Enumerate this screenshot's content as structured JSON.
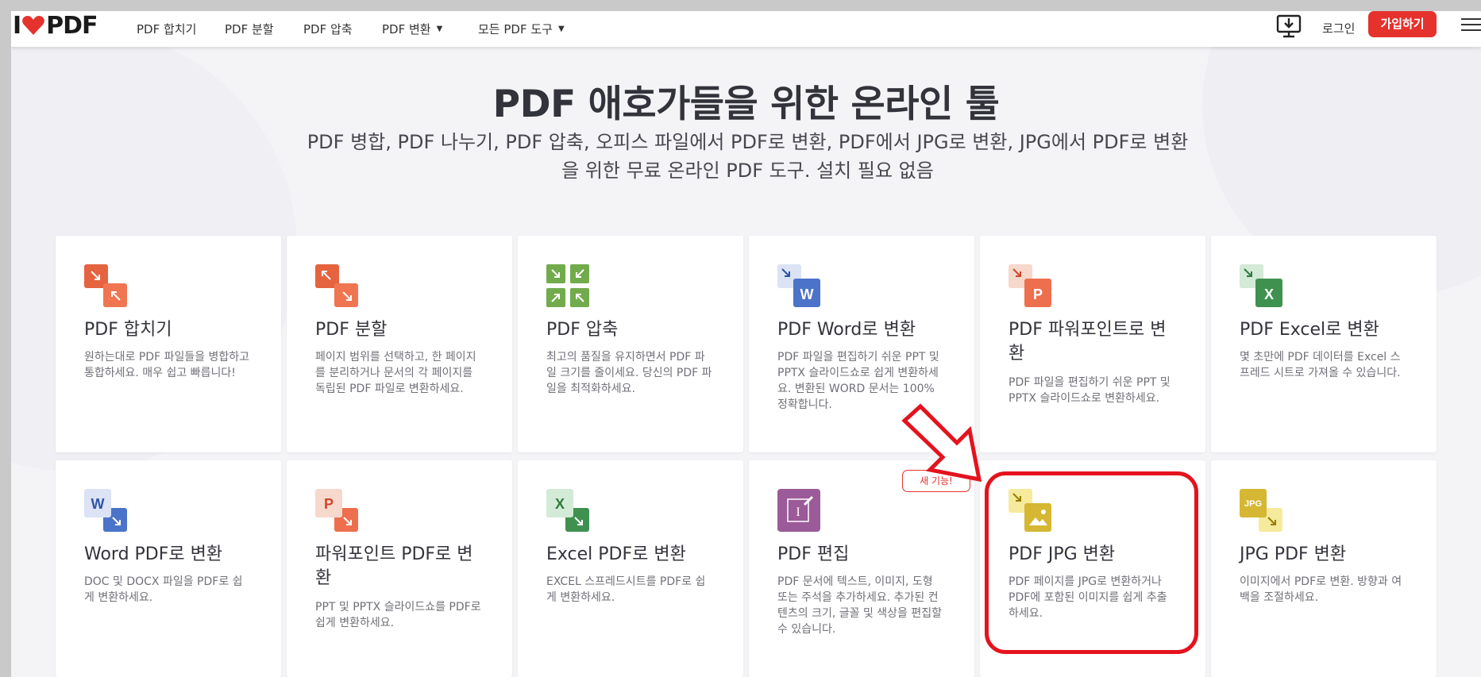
{
  "header": {
    "logo_text_left": "I",
    "logo_text_right": "PDF",
    "nav": [
      {
        "label": "PDF 합치기"
      },
      {
        "label": "PDF 분할"
      },
      {
        "label": "PDF 압축"
      },
      {
        "label": "PDF 변환",
        "dropdown": true
      },
      {
        "label": "모든 PDF 도구",
        "dropdown": true
      }
    ],
    "login": "로그인",
    "signup": "가입하기",
    "icons": [
      "desktop-download-icon",
      "menu-icon"
    ]
  },
  "hero": {
    "title": "PDF 애호가들을 위한 온라인 툴",
    "subtitle": "PDF 병합, PDF 나누기, PDF 압축, 오피스 파일에서 PDF로 변환, PDF에서 JPG로 변환, JPG에서 PDF로 변환을 위한 무료 온라인 PDF 도구. 설치 필요 없음"
  },
  "tools": [
    {
      "title": "PDF 합치기",
      "desc": "원하는대로 PDF 파일들을 병합하고 통합하세요. 매우 쉽고 빠릅니다!",
      "icon": "merge-icon",
      "color": "#e5633f"
    },
    {
      "title": "PDF 분할",
      "desc": "페이지 범위를 선택하고, 한 페이지를 분리하거나 문서의 각 페이지를 독립된 PDF 파일로 변환하세요.",
      "icon": "split-icon",
      "color": "#e5633f"
    },
    {
      "title": "PDF 압축",
      "desc": "최고의 품질을 유지하면서 PDF 파일 크기를 줄이세요. 당신의 PDF 파일을 최적화하세요.",
      "icon": "compress-icon",
      "color": "#72ab4b"
    },
    {
      "title": "PDF Word로 변환",
      "desc": "PDF 파일을 편집하기 쉬운 PPT 및 PPTX 슬라이드쇼로 쉽게 변환하세요. 변환된 WORD 문서는 100% 정확합니다.",
      "icon": "pdf-to-word-icon",
      "color": "#4a73c9"
    },
    {
      "title": "PDF 파워포인트로 변환",
      "desc": "PDF 파일을 편집하기 쉬운 PPT 및 PPTX 슬라이드쇼로 변환하세요.",
      "icon": "pdf-to-powerpoint-icon",
      "color": "#ee6f4e"
    },
    {
      "title": "PDF Excel로 변환",
      "desc": "몇 초만에 PDF 데이터를 Excel 스프레드 시트로 가져올 수 있습니다.",
      "icon": "pdf-to-excel-icon",
      "color": "#3f9150"
    },
    {
      "title": "Word PDF로 변환",
      "desc": "DOC 및 DOCX 파일을 PDF로 쉽게 변환하세요.",
      "icon": "word-to-pdf-icon",
      "color": "#4a73c9"
    },
    {
      "title": "파워포인트 PDF로 변환",
      "desc": "PPT 및 PPTX 슬라이드쇼를 PDF로 쉽게 변환하세요.",
      "icon": "powerpoint-to-pdf-icon",
      "color": "#ee6f4e"
    },
    {
      "title": "Excel PDF로 변환",
      "desc": "EXCEL 스프레드시트를 PDF로 쉽게 변환하세요.",
      "icon": "excel-to-pdf-icon",
      "color": "#3f9150"
    },
    {
      "title": "PDF 편집",
      "desc": "PDF 문서에 텍스트, 이미지, 도형 또는 주석을 추가하세요. 추가된 컨텐츠의 크기, 글꼴 및 색상을 편집할 수 있습니다.",
      "icon": "edit-pdf-icon",
      "color": "#9b5a98",
      "badge": "새 기능!"
    },
    {
      "title": "PDF JPG 변환",
      "desc": "PDF 페이지를 JPG로 변환하거나 PDF에 포함된 이미지를 쉽게 추출하세요.",
      "icon": "pdf-to-jpg-icon",
      "color": "#d6b733",
      "highlighted": true
    },
    {
      "title": "JPG PDF 변환",
      "desc": "이미지에서 PDF로 변환. 방향과 여백을 조절하세요.",
      "icon": "jpg-to-pdf-icon",
      "color": "#d6b733",
      "icon_text": "JPG"
    }
  ],
  "icon_letters": {
    "word": "W",
    "powerpoint": "P",
    "excel": "X"
  },
  "accent": "#e5322d"
}
